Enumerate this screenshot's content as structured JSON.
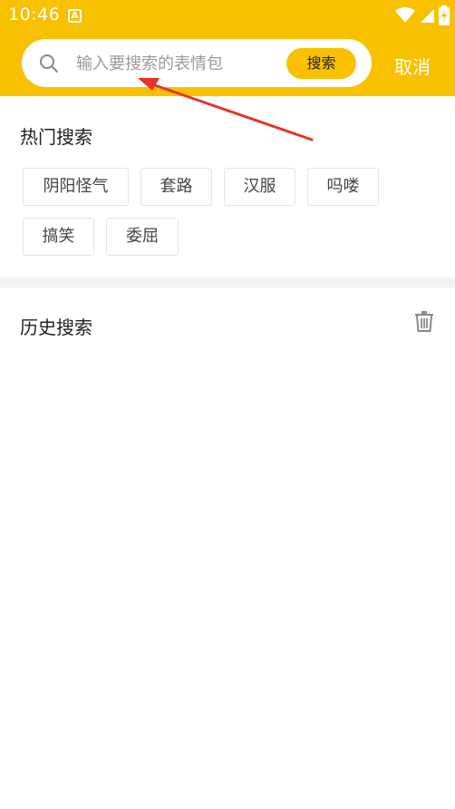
{
  "status_bar": {
    "time": "10:46",
    "app_icon_letter": "A",
    "icons": [
      "wifi-icon",
      "signal-icon",
      "battery-charging-icon"
    ]
  },
  "search": {
    "placeholder": "输入要搜索的表情包",
    "value": "",
    "button_label": "搜索",
    "icon": "search-icon"
  },
  "cancel_label": "取消",
  "hot_search": {
    "title": "热门搜索",
    "tags": [
      "阴阳怪气",
      "套路",
      "汉服",
      "吗喽",
      "搞笑",
      "委屈"
    ]
  },
  "history_search": {
    "title": "历史搜索",
    "clear_icon": "trash-icon"
  },
  "colors": {
    "accent": "#f8c100",
    "annotation_arrow": "#e8332a"
  }
}
